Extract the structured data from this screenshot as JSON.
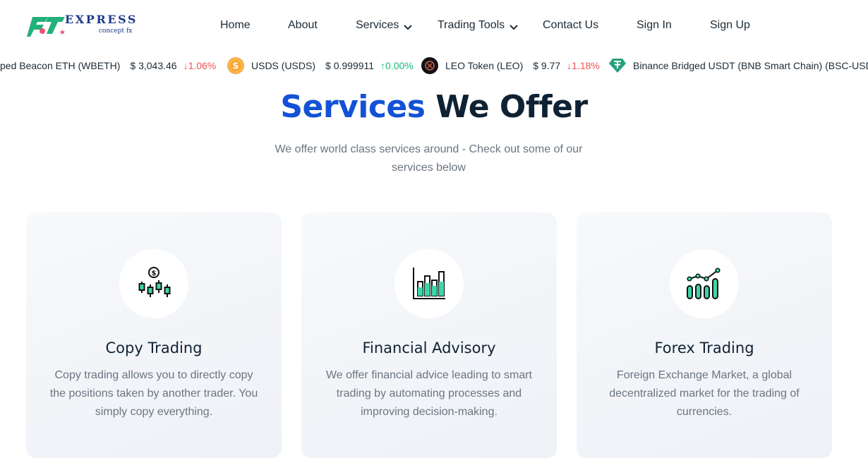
{
  "brand": {
    "name": "EXPRESS",
    "tagline": "concept fx"
  },
  "nav": {
    "home": "Home",
    "about": "About",
    "services": "Services",
    "trading_tools": "Trading Tools",
    "contact": "Contact Us",
    "sign_in": "Sign In",
    "sign_up": "Sign Up"
  },
  "ticker": [
    {
      "name": "ped Beacon ETH (WBETH)",
      "price": "$ 3,043.46",
      "change": "1.06%",
      "direction": "down",
      "icon": "none"
    },
    {
      "name": "USDS (USDS)",
      "price": "$ 0.999911",
      "change": "0.00%",
      "direction": "up",
      "icon": "usds-coin-icon"
    },
    {
      "name": "LEO Token (LEO)",
      "price": "$ 9.77",
      "change": "1.18%",
      "direction": "down",
      "icon": "leo-coin-icon"
    },
    {
      "name": "Binance Bridged USDT (BNB Smart Chain) (BSC-USD)",
      "price": "",
      "change": "",
      "direction": "",
      "icon": "tether-coin-icon"
    }
  ],
  "section": {
    "title_highlight": "Services",
    "title_rest": "We Offer",
    "subtitle": "We offer world class services around - Check out some of our services below"
  },
  "cards": [
    {
      "title": "Copy Trading",
      "description": "Copy trading allows you to directly copy the positions taken by another trader. You simply copy everything.",
      "icon": "copy-trading-icon"
    },
    {
      "title": "Financial Advisory",
      "description": "We offer financial advice leading to smart trading by automating processes and improving decision-making.",
      "icon": "financial-advisory-icon"
    },
    {
      "title": "Forex Trading",
      "description": "Foreign Exchange Market, a global decentralized market for the trading of currencies.",
      "icon": "forex-trading-icon"
    }
  ],
  "colors": {
    "accent_blue": "#1352d6",
    "dark": "#0f2233",
    "teal": "#3dd6a8",
    "down": "#ef5350",
    "up": "#16b979"
  }
}
